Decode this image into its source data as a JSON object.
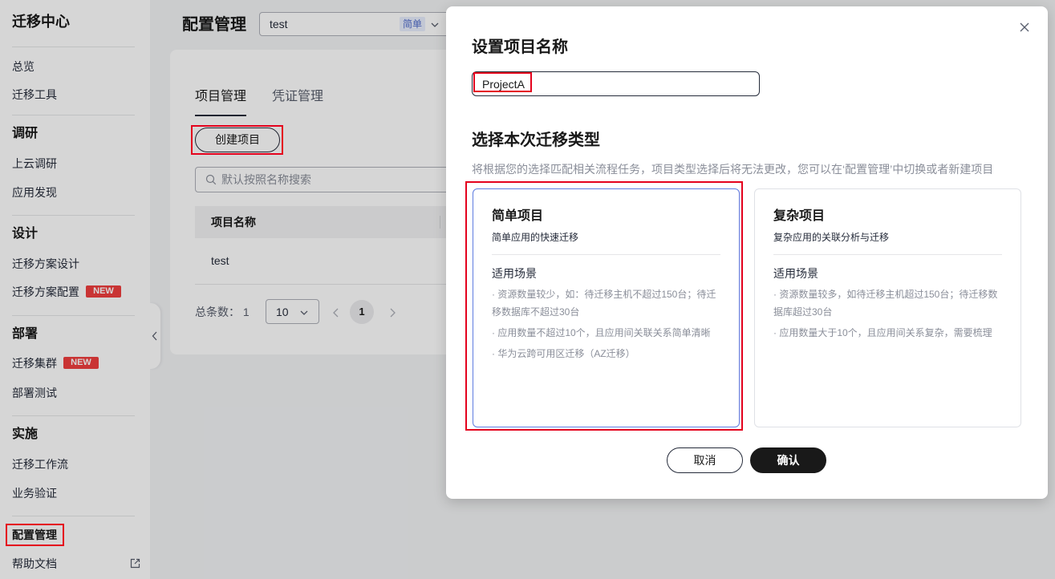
{
  "sidebar": {
    "title": "迁移中心",
    "top_items": [
      {
        "label": "总览"
      },
      {
        "label": "迁移工具"
      }
    ],
    "sections": [
      {
        "heading": "调研",
        "items": [
          {
            "label": "上云调研"
          },
          {
            "label": "应用发现"
          }
        ]
      },
      {
        "heading": "设计",
        "items": [
          {
            "label": "迁移方案设计"
          },
          {
            "label": "迁移方案配置",
            "badge": "NEW"
          }
        ]
      },
      {
        "heading": "部署",
        "items": [
          {
            "label": "迁移集群",
            "badge": "NEW"
          },
          {
            "label": "部署测试"
          }
        ]
      },
      {
        "heading": "实施",
        "items": [
          {
            "label": "迁移工作流"
          },
          {
            "label": "业务验证"
          }
        ]
      }
    ],
    "bottom_items": [
      {
        "label": "配置管理",
        "active": true
      },
      {
        "label": "帮助文档",
        "icon": "external-link-icon"
      }
    ],
    "collapse_icon": "chevron-left-icon"
  },
  "header": {
    "title": "配置管理",
    "project_select": {
      "value": "test",
      "badge": "简单",
      "icon": "chevron-down-icon"
    }
  },
  "tabs": [
    {
      "label": "项目管理",
      "active": true
    },
    {
      "label": "凭证管理",
      "active": false
    }
  ],
  "toolbar": {
    "create_label": "创建项目"
  },
  "search": {
    "placeholder": "默认按照名称搜索",
    "icon": "search-icon"
  },
  "table": {
    "columns": [
      "项目名称"
    ],
    "rows": [
      [
        "test"
      ]
    ]
  },
  "pagination": {
    "total_label": "总条数：",
    "total": "1",
    "page_size": "10",
    "current_page": "1",
    "prev_icon": "chevron-left-icon",
    "next_icon": "chevron-right-icon"
  },
  "modal": {
    "title": "设置项目名称",
    "close_icon": "close-icon",
    "name_input": {
      "value": "ProjectA"
    },
    "type_title": "选择本次迁移类型",
    "type_description": "将根据您的选择匹配相关流程任务，项目类型选择后将无法更改，您可以在‘配置管理’中切换或者新建项目",
    "options": [
      {
        "title": "简单项目",
        "subtitle": "简单应用的快速迁移",
        "scenario_label": "适用场景",
        "bullets": [
          "· 资源数量较少，如：待迁移主机不超过150台；待迁移数据库不超过30台",
          "· 应用数量不超过10个，且应用间关联关系简单清晰",
          "· 华为云跨可用区迁移（AZ迁移）"
        ],
        "selected": true
      },
      {
        "title": "复杂项目",
        "subtitle": "复杂应用的关联分析与迁移",
        "scenario_label": "适用场景",
        "bullets": [
          "· 资源数量较多，如待迁移主机超过150台；待迁移数据库超过30台",
          "· 应用数量大于10个，且应用间关系复杂，需要梳理"
        ],
        "selected": false
      }
    ],
    "cancel_label": "取消",
    "confirm_label": "确认"
  },
  "colors": {
    "primary_dark": "#252b3a",
    "selected_border": "#5e7ce0",
    "badge_new": "#f03e3e",
    "badge_simple_bg": "#e8edfd",
    "badge_simple_text": "#526ecc",
    "annotation_red": "#e4021d",
    "mask": "rgba(0,0,0,0.16)"
  }
}
